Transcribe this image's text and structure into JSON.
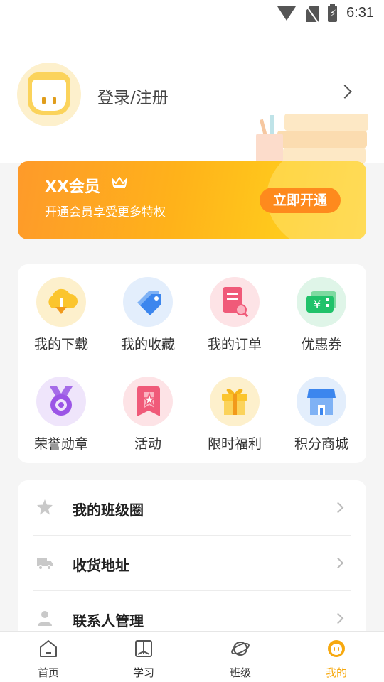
{
  "status_bar": {
    "time": "6:31"
  },
  "header": {
    "login_label": "登录/注册"
  },
  "vip": {
    "title": "XX会员",
    "subtitle": "开通会员享受更多特权",
    "button": "立即开通"
  },
  "grid": {
    "items": [
      {
        "label": "我的下载",
        "icon": "cloud-download-icon"
      },
      {
        "label": "我的收藏",
        "icon": "tag-favorite-icon"
      },
      {
        "label": "我的订单",
        "icon": "order-document-icon"
      },
      {
        "label": "优惠券",
        "icon": "coupon-icon"
      },
      {
        "label": "荣誉勋章",
        "icon": "medal-icon"
      },
      {
        "label": "活动",
        "icon": "activity-star-icon"
      },
      {
        "label": "限时福利",
        "icon": "gift-icon"
      },
      {
        "label": "积分商城",
        "icon": "store-icon"
      }
    ]
  },
  "list": {
    "items": [
      {
        "label": "我的班级圈",
        "icon": "star-icon"
      },
      {
        "label": "收货地址",
        "icon": "truck-icon"
      },
      {
        "label": "联系人管理",
        "icon": "person-icon"
      }
    ]
  },
  "bottom_nav": {
    "items": [
      {
        "label": "首页",
        "icon": "home-icon"
      },
      {
        "label": "学习",
        "icon": "book-icon"
      },
      {
        "label": "班级",
        "icon": "planet-icon"
      },
      {
        "label": "我的",
        "icon": "smiley-icon"
      }
    ],
    "active_color": "#f7a90f"
  },
  "colors": {
    "accent": "#ffb21a",
    "button": "#fe8a1d",
    "background": "#f5f5f5"
  }
}
